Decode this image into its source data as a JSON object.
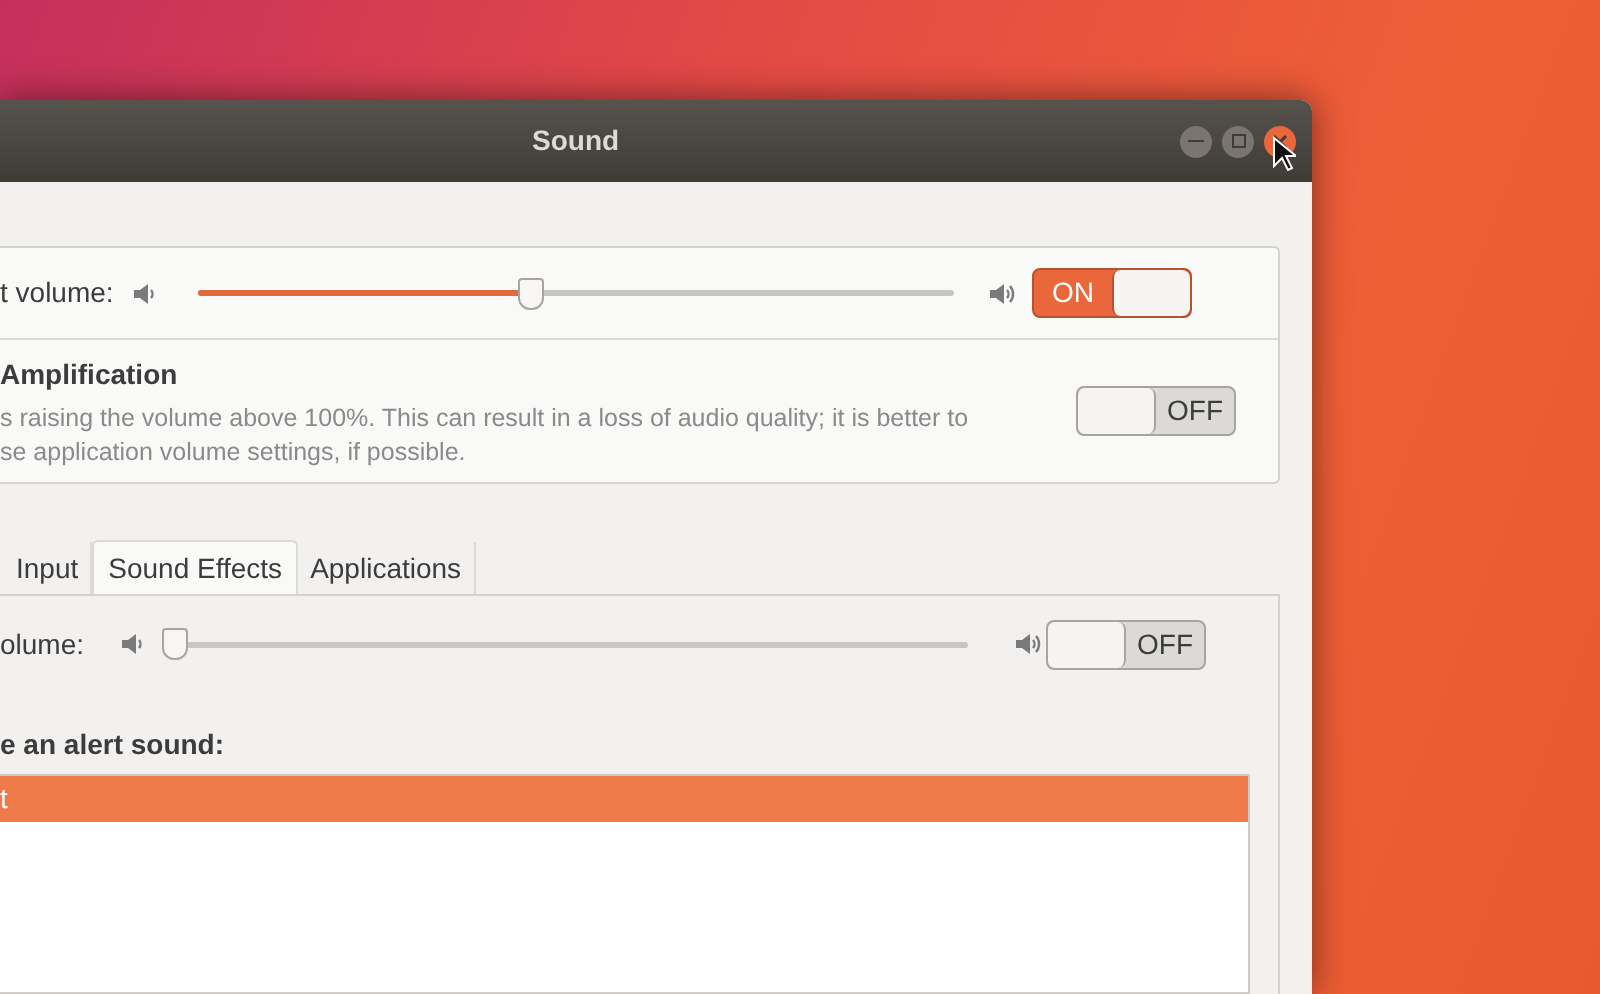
{
  "window": {
    "title": "Sound"
  },
  "output": {
    "volume": {
      "label": "t volume:",
      "level": 0.44,
      "on": true,
      "text": "ON"
    },
    "amplification": {
      "title": "Amplification",
      "description_lines": [
        "s raising the volume above 100%. This can result in a loss of audio quality; it is better to",
        "se application volume settings, if possible."
      ],
      "on": false,
      "text": "OFF"
    }
  },
  "tabs": [
    {
      "label": "Input",
      "selected": false
    },
    {
      "label": "Sound Effects",
      "selected": true
    },
    {
      "label": "Applications",
      "selected": false
    }
  ],
  "sound_effects": {
    "volume": {
      "label": "olume:",
      "level": 0,
      "on": false,
      "text": "OFF"
    },
    "alert_heading": "e an alert sound:",
    "alerts": [
      {
        "label": "t",
        "selected": true
      }
    ]
  }
}
